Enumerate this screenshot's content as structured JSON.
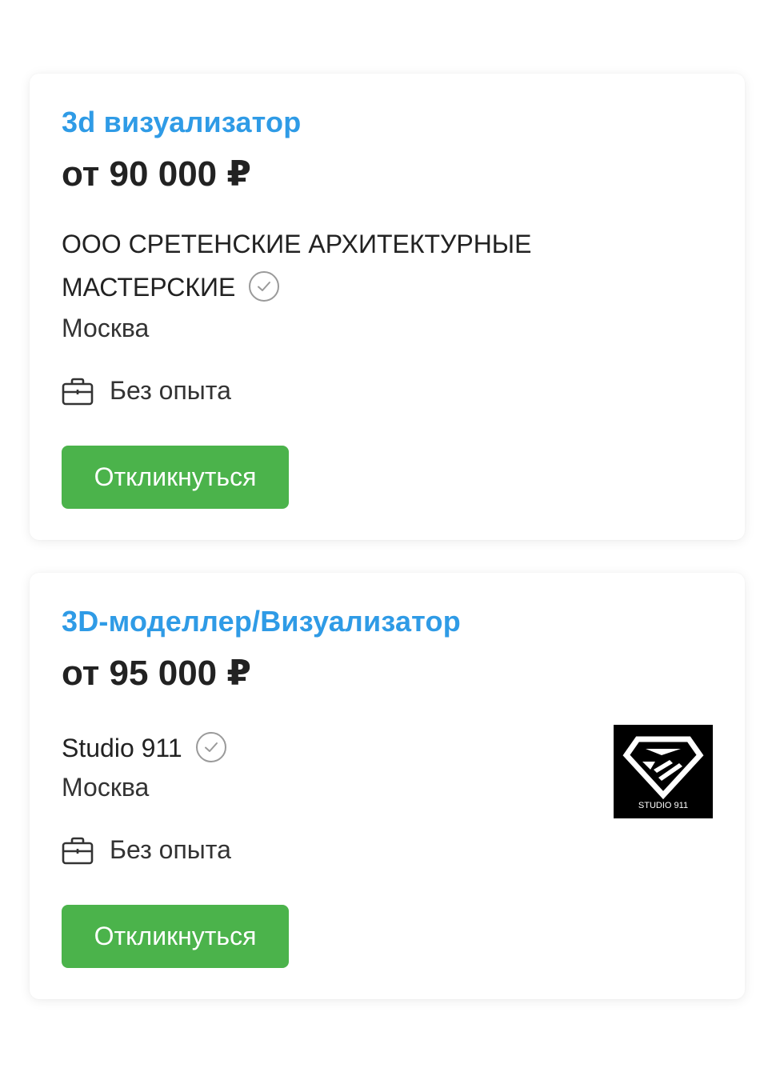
{
  "vacancies": [
    {
      "title": "3d визуализатор",
      "salary": "от 90 000 ₽",
      "company": "ООО СРЕТЕНСКИЕ АРХИТЕКТУРНЫЕ МАСТЕРСКИЕ",
      "city": "Москва",
      "experience": "Без опыта",
      "apply_label": "Откликнуться",
      "verified_icon": "verified-check-icon",
      "experience_icon": "briefcase-icon"
    },
    {
      "title": "3D-моделлер/Визуализатор",
      "salary": "от 95 000 ₽",
      "company": "Studio 911",
      "city": "Москва",
      "experience": "Без опыта",
      "apply_label": "Откликнуться",
      "verified_icon": "verified-check-icon",
      "experience_icon": "briefcase-icon",
      "logo_text": "STUDIO 911"
    }
  ],
  "colors": {
    "title": "#2f9be6",
    "button": "#4bb34b",
    "text": "#222222"
  }
}
